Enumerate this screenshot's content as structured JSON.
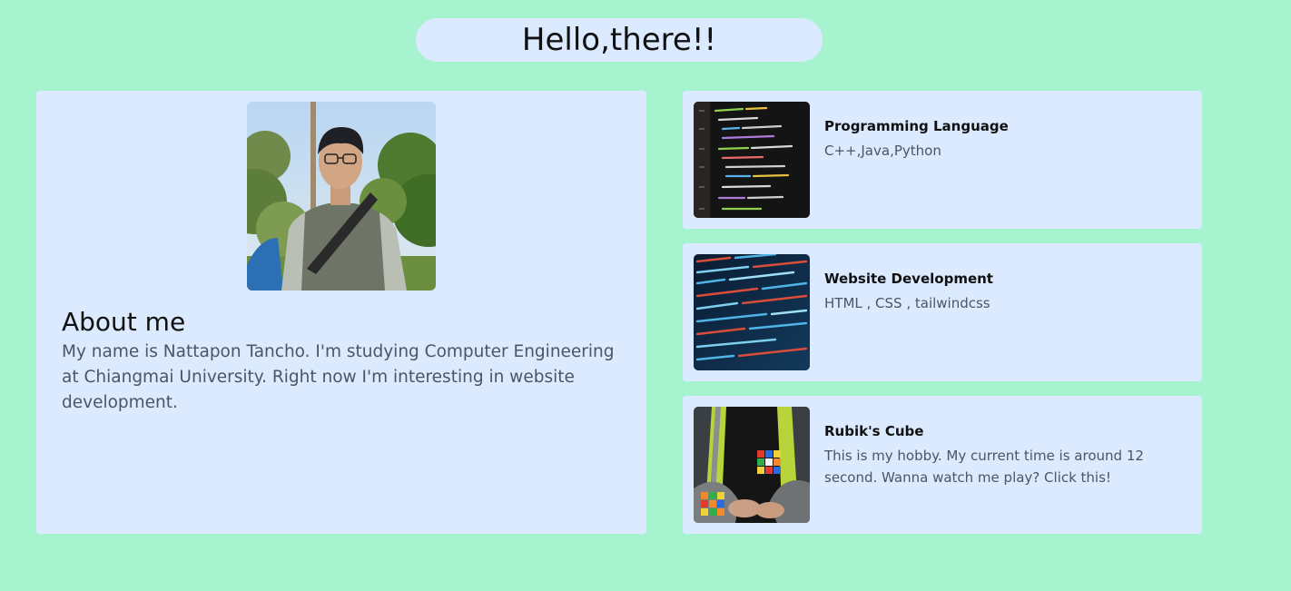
{
  "header": {
    "greeting": "Hello,there!!"
  },
  "about": {
    "title": "About me",
    "text": "My name is Nattapon Tancho. I'm studying Computer Engineering at Chiangmai University. Right now I'm interesting in website development."
  },
  "skills": [
    {
      "title": "Programming Language",
      "description": "C++,Java,Python",
      "thumb_icon": "code-screen-image"
    },
    {
      "title": "Website Development",
      "description": "HTML , CSS , tailwindcss",
      "thumb_icon": "code-matrix-image"
    },
    {
      "title": "Rubik's Cube",
      "description": "This is my hobby. My current time is around 12 second. Wanna watch me play? Click this!",
      "thumb_icon": "rubiks-cube-image"
    }
  ],
  "colors": {
    "background": "#a7f3d0",
    "card": "#dbeafe",
    "text_muted": "#4b5563"
  }
}
